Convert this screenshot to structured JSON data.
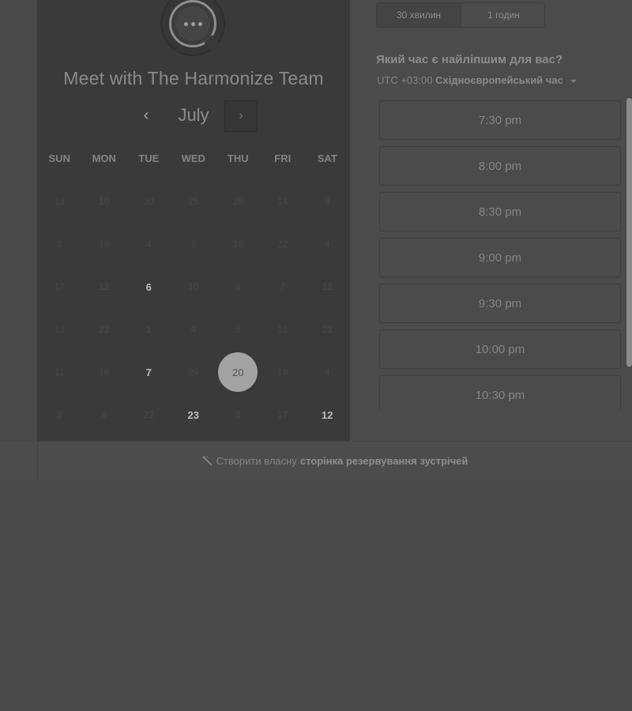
{
  "booking": {
    "title": "Meet with The Harmonize Team",
    "month": "July",
    "prev_symbol": "‹",
    "next_symbol": "›",
    "weekdays": [
      "SUN",
      "MON",
      "TUE",
      "WED",
      "THU",
      "FRI",
      "SAT"
    ],
    "days": [
      [
        "19",
        "10",
        "30",
        "25",
        "25",
        "14",
        "3"
      ],
      [
        "2",
        "19",
        "4",
        "1",
        "19",
        "22",
        "4"
      ],
      [
        "17",
        "12",
        "6",
        "10",
        "9",
        "7",
        "12"
      ],
      [
        "13",
        "22",
        "1",
        "4",
        "5",
        "16",
        "21"
      ],
      [
        "11",
        "16",
        "7",
        "29",
        "20",
        "18",
        "4"
      ],
      [
        "2",
        "6",
        "22",
        "23",
        "2",
        "17",
        "12"
      ]
    ],
    "available_days": [
      "2-2",
      "4-2",
      "4-4",
      "5-3",
      "5-6"
    ],
    "selected_day": "20"
  },
  "duration": {
    "options": [
      "30 хвилин",
      "1 годин"
    ]
  },
  "schedule": {
    "question": "Який час є найліпшим для вас?",
    "tz_offset": "UTC +03:00",
    "tz_name": "Східноєвропейський час",
    "slots": [
      "7:30 pm",
      "8:00 pm",
      "8:30 pm",
      "9:00 pm",
      "9:30 pm",
      "10:00 pm",
      "10:30 pm"
    ]
  },
  "footer": {
    "prefix": "Створити власну",
    "bold": "сторінка резервування зустрічей"
  },
  "colors": {
    "overlay": "#4a4a4a",
    "panel": "#3a3a3a",
    "selected": "#a3a3a3"
  }
}
